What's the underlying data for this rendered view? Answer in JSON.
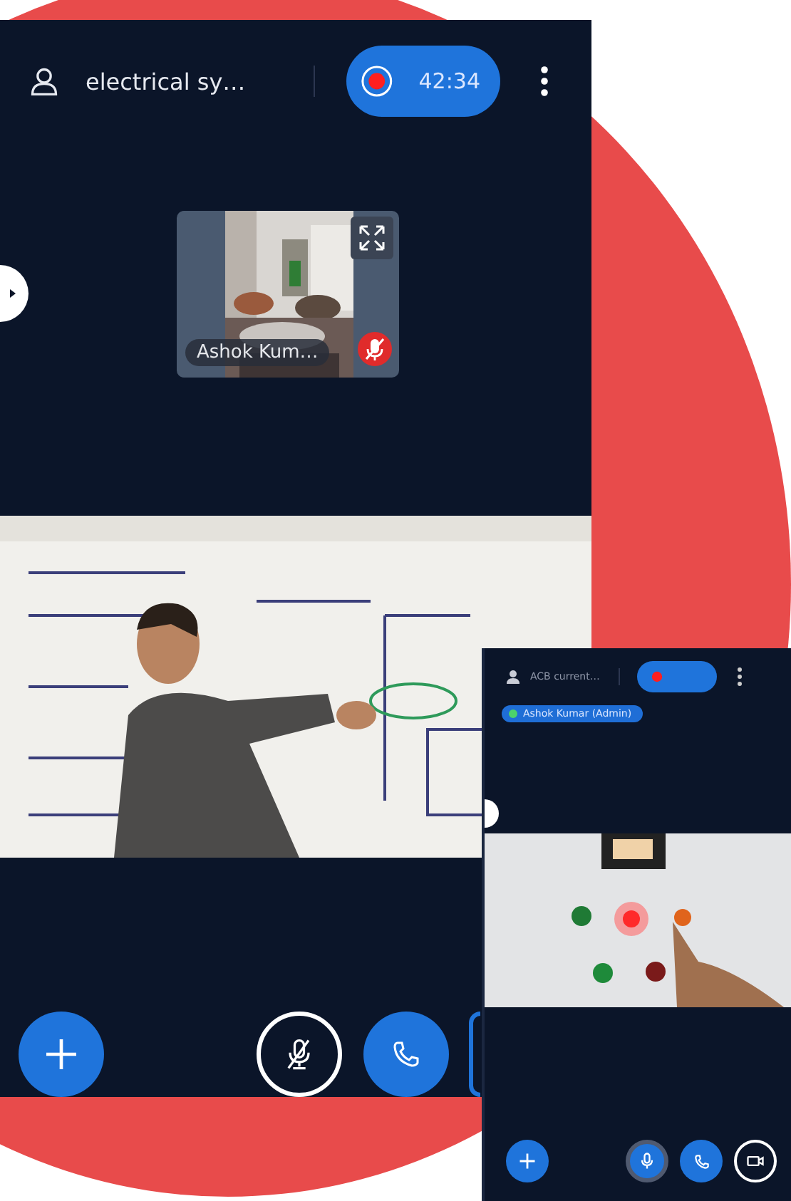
{
  "main_screen": {
    "header": {
      "title": "electrical sy…",
      "recording": true,
      "timer": "42:34"
    },
    "thumbnail": {
      "name": "Ashok Kum…",
      "muted": true
    },
    "controls": {
      "mic_muted": true
    }
  },
  "secondary_screen": {
    "header": {
      "title": "ACB current…",
      "recording": true
    },
    "presenter_badge": "Ashok Kumar (Admin)",
    "controls": {
      "mic_muted": false
    }
  }
}
